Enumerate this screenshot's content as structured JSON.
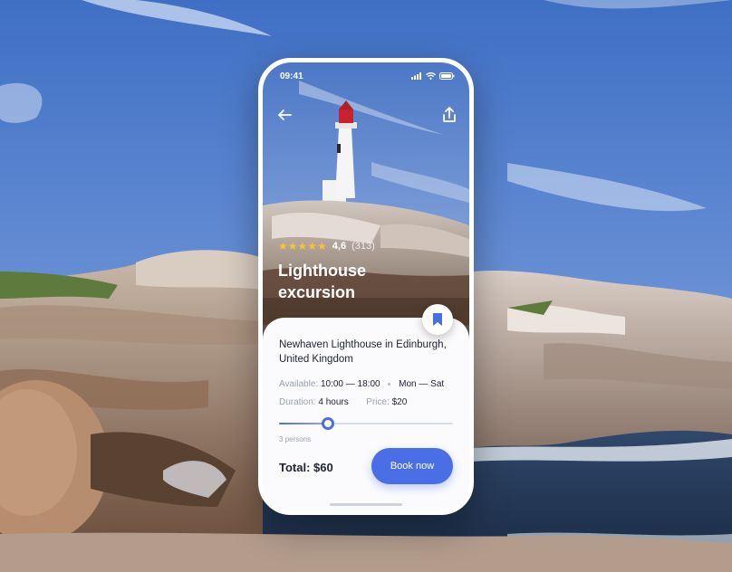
{
  "status_bar": {
    "time": "09:41"
  },
  "hero": {
    "rating": {
      "stars": "★★★★★",
      "score": "4,6",
      "count": "(313)"
    },
    "title": "Lighthouse excursion"
  },
  "card": {
    "place": "Newhaven Lighthouse in Edinburgh, United Kingdom",
    "available_label": "Available:",
    "available_time": "10:00 — 18:00",
    "available_days": "Mon — Sat",
    "duration_label": "Duration:",
    "duration_value": "4 hours",
    "price_label": "Price:",
    "price_value": "$20",
    "persons": {
      "label": "3 persons",
      "fraction": 0.28
    },
    "total": "Total: $60",
    "book_label": "Book now"
  },
  "colors": {
    "accent": "#4a6ee6",
    "star": "#f7c531",
    "text_dark": "#1f2233",
    "text_muted": "#9aa0b4"
  },
  "icons": [
    "back-arrow-icon",
    "share-icon",
    "bookmark-icon",
    "signal-icon",
    "wifi-icon",
    "battery-icon",
    "star-icon"
  ]
}
